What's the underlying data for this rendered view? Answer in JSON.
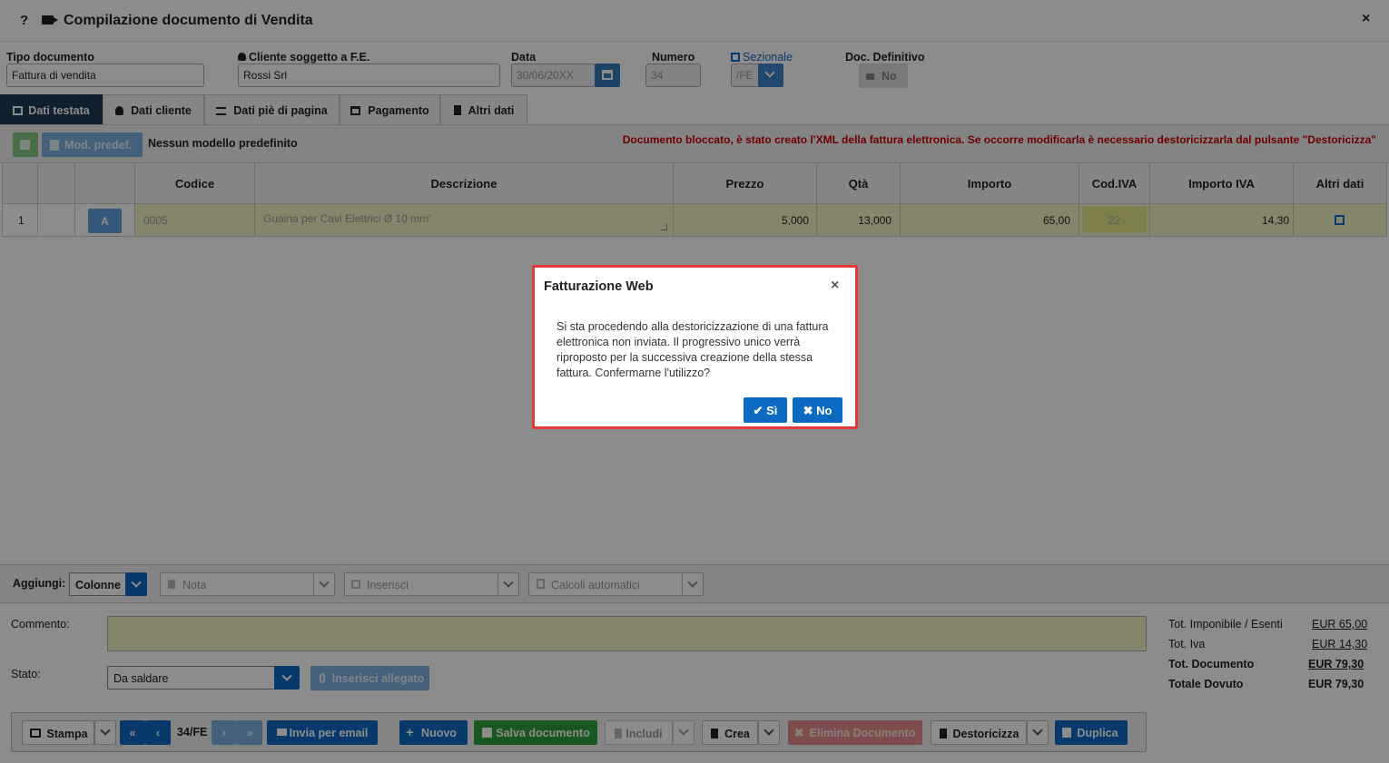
{
  "window": {
    "title": "Compilazione documento di Vendita",
    "help": "?",
    "close": "×"
  },
  "header": {
    "tipo_documento": {
      "label": "Tipo documento",
      "value": "Fattura di vendita"
    },
    "cliente": {
      "label": "Cliente soggetto a F.E.",
      "value": "Rossi Srl"
    },
    "data": {
      "label": "Data",
      "value": "30/06/20XX"
    },
    "numero": {
      "label": "Numero",
      "value": "34"
    },
    "sezionale": {
      "label": "Sezionale",
      "value": "/FE"
    },
    "definitivo": {
      "label": "Doc. Definitivo",
      "value": "No"
    }
  },
  "tabs": [
    {
      "label": "Dati testata"
    },
    {
      "label": "Dati cliente"
    },
    {
      "label": "Dati piè di pagina"
    },
    {
      "label": "Pagamento"
    },
    {
      "label": "Altri dati"
    }
  ],
  "toolbar": {
    "mod_predef": "Mod. predef.",
    "model_text": "Nessun modello predefinito",
    "warning": "Documento bloccato, è stato creato l'XML della fattura elettronica. Se occorre modificarla è necessario destoricizzarla dal pulsante \"Destoricizza\""
  },
  "table": {
    "headers": {
      "codice": "Codice",
      "descrizione": "Descrizione",
      "prezzo": "Prezzo",
      "qta": "Qtà",
      "importo": "Importo",
      "codiva": "Cod.IVA",
      "importo_iva": "Importo IVA",
      "altri": "Altri dati"
    },
    "rows": [
      {
        "n": "1",
        "a": "A",
        "codice": "0005",
        "descrizione": "Guaina per Cavi Elettrici Ø 10 mm'",
        "prezzo": "5,000",
        "qta": "13,000",
        "importo": "65,00",
        "codiva": "22",
        "importo_iva": "14,30"
      }
    ]
  },
  "add_bar": {
    "label": "Aggiungi:",
    "colonne": "Colonne",
    "nota": "Nota",
    "inserisci": "Inserisci",
    "calcoli": "Calcoli automatici"
  },
  "footer": {
    "commento_label": "Commento:",
    "stato_label": "Stato:",
    "stato_value": "Da saldare",
    "allegato": "Inserisci allegato"
  },
  "totals": [
    {
      "label": "Tot. Imponibile / Esenti",
      "value": "EUR 65,00"
    },
    {
      "label": "Tot. Iva",
      "value": "EUR 14,30"
    },
    {
      "label": "Tot. Documento",
      "value": "EUR 79,30"
    },
    {
      "label": "Totale Dovuto",
      "value": "EUR 79,30"
    }
  ],
  "actions": {
    "stampa": "Stampa",
    "page": "34/FE",
    "invia": "Invia per email",
    "nuovo": "Nuovo",
    "salva": "Salva documento",
    "includi": "Includi",
    "crea": "Crea",
    "elimina": "Elimina Documento",
    "destoricizza": "Destoricizza",
    "duplica": "Duplica"
  },
  "dialog": {
    "title": "Fatturazione Web",
    "message": "Si sta procedendo alla destoricizzazione di una fattura elettronica non inviata. Il progressivo unico verrà riproposto per la successiva creazione della stessa fattura. Confermarne l'utilizzo?",
    "yes": "✔ Sì",
    "no": "✖ No",
    "close": "×"
  },
  "colors": {
    "primary": "#0d6ac2",
    "warning": "#cc0000",
    "success": "#2e9e3e",
    "danger": "#e58a8a",
    "highlight": "#f3f3c4"
  }
}
